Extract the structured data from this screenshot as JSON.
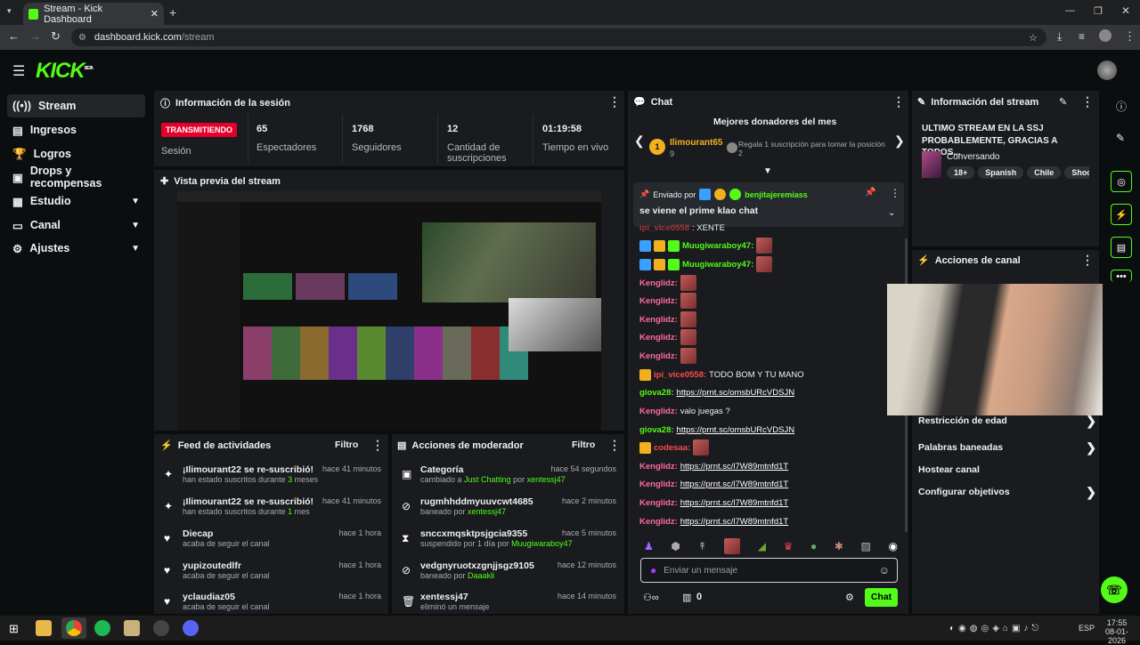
{
  "browser": {
    "tab_title": "Stream - Kick Dashboard",
    "url_host": "dashboard.kick.com",
    "url_path": "/stream"
  },
  "app": {
    "logo_text": "KICK",
    "logo_sup": "BETA"
  },
  "sidebar": {
    "items": [
      {
        "label": "Stream",
        "icon": "broadcast-icon",
        "active": true
      },
      {
        "label": "Ingresos",
        "icon": "money-icon"
      },
      {
        "label": "Logros",
        "icon": "trophy-icon"
      },
      {
        "label": "Drops y recompensas",
        "icon": "gift-icon"
      },
      {
        "label": "Estudio",
        "icon": "studio-icon",
        "expand": true
      },
      {
        "label": "Canal",
        "icon": "channel-icon",
        "expand": true
      },
      {
        "label": "Ajustes",
        "icon": "gear-icon",
        "expand": true
      }
    ]
  },
  "session": {
    "title": "Información de la sesión",
    "live_badge": "TRANSMITIENDO",
    "session_label": "Sesión",
    "stats": [
      {
        "value": "65",
        "label": "Espectadores"
      },
      {
        "value": "1768",
        "label": "Seguidores"
      },
      {
        "value": "12",
        "label": "Cantidad de suscripciones"
      },
      {
        "value": "01:19:58",
        "label": "Tiempo en vivo"
      }
    ]
  },
  "preview": {
    "title": "Vista previa del stream"
  },
  "feed": {
    "title": "Feed de actividades",
    "filter": "Filtro",
    "items": [
      {
        "title": "¡Ilimourant22 se re-suscribió!",
        "sub_pre": "han estado suscritos durante ",
        "sub_num": "3",
        "sub_post": " meses",
        "time": "hace 41 minutos",
        "icon": "sparkle-icon"
      },
      {
        "title": "¡Ilimourant22 se re-suscribió!",
        "sub_pre": "han estado suscritos durante ",
        "sub_num": "1",
        "sub_post": " mes",
        "time": "hace 41 minutos",
        "icon": "sparkle-icon"
      },
      {
        "title": "Diecap",
        "sub_pre": "acaba de seguir el canal",
        "sub_num": "",
        "sub_post": "",
        "time": "hace 1 hora",
        "icon": "heart-icon"
      },
      {
        "title": "yupizoutedlfr",
        "sub_pre": "acaba de seguir el canal",
        "sub_num": "",
        "sub_post": "",
        "time": "hace 1 hora",
        "icon": "heart-icon"
      },
      {
        "title": "yclaudiaz05",
        "sub_pre": "acaba de seguir el canal",
        "sub_num": "",
        "sub_post": "",
        "time": "hace 1 hora",
        "icon": "heart-icon"
      }
    ]
  },
  "mod": {
    "title": "Acciones de moderador",
    "filter": "Filtro",
    "items": [
      {
        "title": "Categoría",
        "sub_pre": "cambiado a ",
        "hl1": "Just Chatting",
        "mid": " por ",
        "hl2": "xentessj47",
        "time": "hace 54 segundos",
        "icon": "category-icon"
      },
      {
        "title": "rugmhhddmyuuvcwt4685",
        "sub_pre": "baneado por ",
        "hl1": "xentessj47",
        "mid": "",
        "hl2": "",
        "time": "hace 2 minutos",
        "icon": "ban-icon"
      },
      {
        "title": "snccxmqsktpsjgcia9355",
        "sub_pre": "suspendido por 1 día por ",
        "hl1": "Muugiwaraboy47",
        "mid": "",
        "hl2": "",
        "time": "hace 5 minutos",
        "icon": "hourglass-icon"
      },
      {
        "title": "vedgnyruotxzgnjjsgz9105",
        "sub_pre": "baneado por ",
        "hl1": "Daaakli",
        "mid": "",
        "hl2": "",
        "time": "hace 12 minutos",
        "icon": "ban-icon"
      },
      {
        "title": "xentessj47",
        "sub_pre": "eliminó un mensaje",
        "hl1": "",
        "mid": "",
        "hl2": "",
        "time": "hace 14 minutos",
        "icon": "trash-icon"
      }
    ]
  },
  "chat": {
    "title": "Chat",
    "donors_title": "Mejores donadores del mes",
    "top_donor": "Ilimourant65",
    "top_donor_count": "9",
    "donor_cta": "Regala 1 suscripción para tomar la posición 2",
    "pinned_by_label": "Enviado por",
    "pinned_user": "benjitajeremiass",
    "pinned_msg": "se viene el prime klao chat",
    "partial_line": ": XENTE",
    "messages": [
      {
        "user": "Muugiwaraboy47:",
        "color": "green",
        "text": "",
        "link": "",
        "emote": true
      },
      {
        "user": "Muugiwaraboy47:",
        "color": "green",
        "text": "",
        "link": "",
        "emote": true
      },
      {
        "user": "Kenglidz:",
        "color": "pink",
        "text": "",
        "link": "",
        "emote": true
      },
      {
        "user": "Kenglidz:",
        "color": "pink",
        "text": "",
        "link": "",
        "emote": true
      },
      {
        "user": "Kenglidz:",
        "color": "pink",
        "text": "",
        "link": "",
        "emote": true
      },
      {
        "user": "Kenglidz:",
        "color": "pink",
        "text": "",
        "link": "",
        "emote": true
      },
      {
        "user": "Kenglidz:",
        "color": "pink",
        "text": "",
        "link": "",
        "emote": true
      },
      {
        "user": "ipi_vice0558:",
        "color": "red",
        "text": " TODO BOM Y TU MANO",
        "link": "",
        "emote": false
      },
      {
        "user": "giova28:",
        "color": "green",
        "text": "",
        "link": "https://prnt.sc/omsbURcVDSJN",
        "emote": false
      },
      {
        "user": "Kenglidz:",
        "color": "pink",
        "text": " valo juegas ?",
        "link": "",
        "emote": false
      },
      {
        "user": "giova28:",
        "color": "green",
        "text": "",
        "link": "https://prnt.sc/omsbURcVDSJN",
        "emote": false
      },
      {
        "user": "codesaa:",
        "color": "red",
        "text": "",
        "link": "",
        "emote": true
      },
      {
        "user": "Kenglidz:",
        "color": "pink",
        "text": "",
        "link": "https://prnt.sc/l7W89mtnfd1T",
        "emote": false
      },
      {
        "user": "Kenglidz:",
        "color": "pink",
        "text": "",
        "link": "https://prnt.sc/l7W89mtnfd1T",
        "emote": false
      },
      {
        "user": "Kenglidz:",
        "color": "pink",
        "text": "",
        "link": "https://prnt.sc/l7W89mtnfd1T",
        "emote": false
      },
      {
        "user": "Kenglidz:",
        "color": "pink",
        "text": "",
        "link": "https://prnt.sc/l7W89mtnfd1T",
        "emote": false
      }
    ],
    "input_placeholder": "Enviar un mensaje",
    "send_label": "Chat",
    "viewer_count": "0"
  },
  "stream_info": {
    "title": "Información del stream",
    "stream_title": "ULTIMO STREAM EN LA SSJ PROBABLEMENTE, GRACIAS A TODOS...",
    "category": "Conversando",
    "tags": [
      "18+",
      "Spanish",
      "Chile",
      "Shooter"
    ]
  },
  "channel_actions": {
    "title": "Acciones de canal",
    "items": [
      {
        "label": "Restricción de edad",
        "chevron": true
      },
      {
        "label": "Palabras baneadas",
        "chevron": true
      },
      {
        "label": "Hostear canal",
        "chevron": false
      },
      {
        "label": "Configurar objetivos",
        "chevron": true
      }
    ]
  },
  "taskbar": {
    "time": "17:55",
    "date": "08-01-2026",
    "lang": "ESP"
  },
  "colors": {
    "accent": "#53fc18",
    "panel": "#191b1f",
    "bg": "#0b0e0f",
    "live": "#e4002b"
  }
}
